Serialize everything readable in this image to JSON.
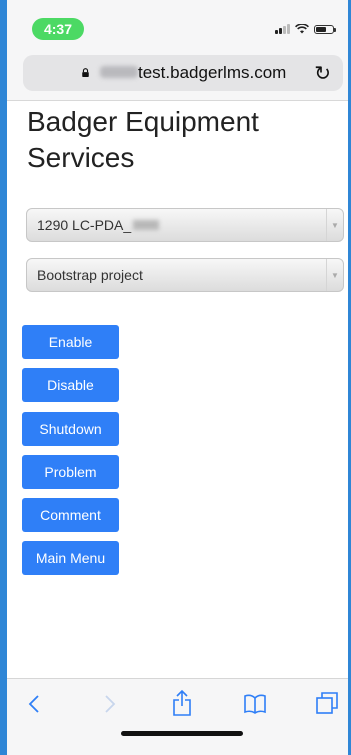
{
  "status_bar": {
    "time": "4:37"
  },
  "browser": {
    "url": "test.badgerlms.com",
    "icons": {
      "lock": "lock-icon",
      "reload": "reload-icon"
    }
  },
  "page": {
    "title": "Badger Equipment Services",
    "selects": [
      {
        "value": "1290 LC-PDA_"
      },
      {
        "value": "Bootstrap project"
      }
    ],
    "buttons": [
      {
        "label": "Enable"
      },
      {
        "label": "Disable"
      },
      {
        "label": "Shutdown"
      },
      {
        "label": "Problem"
      },
      {
        "label": "Comment"
      },
      {
        "label": "Main Menu"
      }
    ]
  },
  "toolbar": {
    "icons": [
      "back-icon",
      "forward-icon",
      "share-icon",
      "bookmarks-icon",
      "tabs-icon"
    ]
  },
  "colors": {
    "accent": "#2f7ff7",
    "time_pill": "#4cd964",
    "frame": "#2f86d6"
  }
}
